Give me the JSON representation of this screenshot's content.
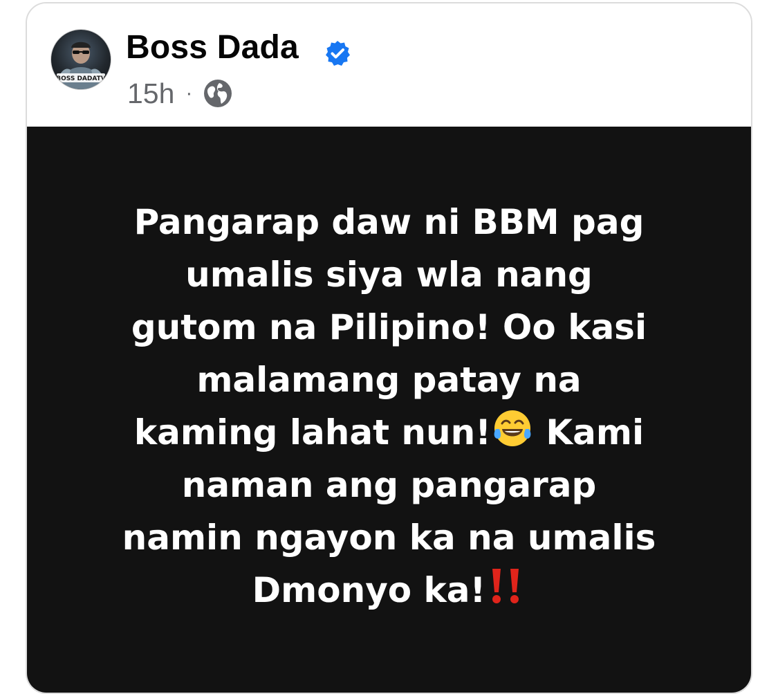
{
  "post": {
    "author": "Boss Dada",
    "verified": true,
    "timestamp": "15h",
    "separator": "·",
    "privacy_icon": "globe-icon",
    "avatar_caption": "BOSS DADATV",
    "background_color": "#121212",
    "text_color": "#ffffff",
    "lines": [
      "Pangarap daw ni BBM pag",
      "umalis siya wla nang",
      "gutom na Pilipino! Oo kasi",
      "malamang patay na",
      "kaming lahat nun!",
      " Kami",
      "naman ang pangarap",
      "namin ngayon ka na umalis",
      "Dmonyo ka!"
    ],
    "emojis": {
      "laugh": "face-with-tears-of-joy",
      "exclaim": "double-exclamation-mark"
    }
  },
  "colors": {
    "verified_blue": "#1877f2",
    "meta_gray": "#65676b",
    "exclaim_red": "#e0241b"
  }
}
